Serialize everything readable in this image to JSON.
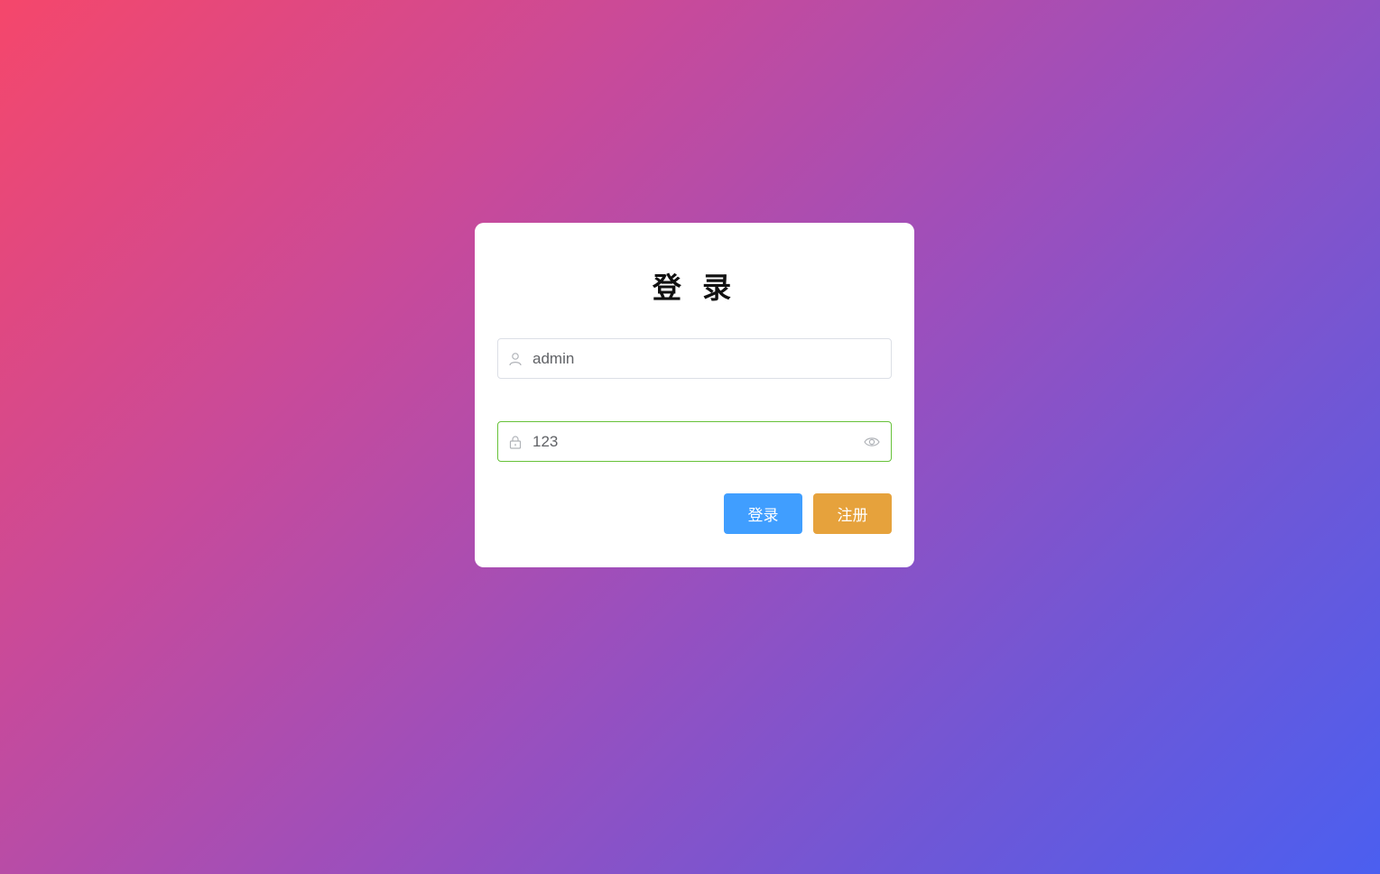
{
  "login_form": {
    "title": "登 录",
    "username": {
      "value": "admin",
      "icon": "user-icon"
    },
    "password": {
      "value": "123",
      "icon": "lock-icon",
      "toggle_icon": "eye-icon"
    },
    "buttons": {
      "login_label": "登录",
      "register_label": "注册"
    }
  },
  "colors": {
    "primary": "#409eff",
    "warning": "#e6a23c",
    "success_border": "#67c23a"
  }
}
